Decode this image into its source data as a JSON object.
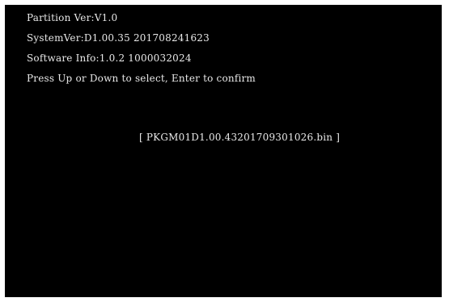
{
  "info": {
    "partition_ver": "Partition Ver:V1.0",
    "system_ver": "SystemVer:D1.00.35 201708241623",
    "software_info": "Software Info:1.0.2 1000032024",
    "instruction": "Press Up or Down to select, Enter to confirm"
  },
  "menu": {
    "selected_item": "[ PKGM01D1.00.43201709301026.bin ]"
  },
  "colors": {
    "background": "#000000",
    "text": "#e8e8e8",
    "frame": "#ffffff"
  }
}
